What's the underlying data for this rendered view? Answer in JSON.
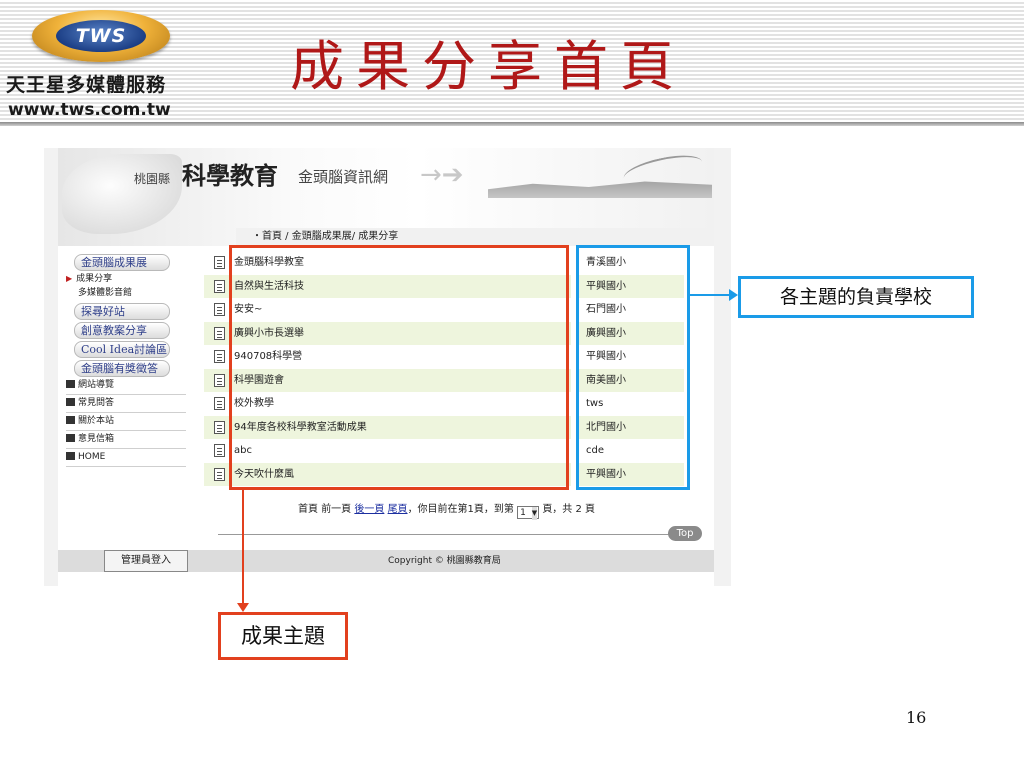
{
  "header": {
    "logo_text": "TWS",
    "brand_zh": "天王星多媒體服務",
    "brand_url": "www.tws.com.tw",
    "slide_title": "成果分享首頁"
  },
  "site": {
    "county": "桃園縣",
    "title": "科學教育",
    "subtitle": "金頭腦資訊網",
    "breadcrumb": "・首頁 / 金頭腦成果展/ 成果分享",
    "menu": {
      "section1": "金頭腦成果展",
      "item_share": "成果分享",
      "item_media": "多媒體影音館",
      "section2": "探尋好站",
      "section3": "創意教案分享",
      "section4": "Cool Idea討論區",
      "section5": "金頭腦有獎徵答",
      "util1": "網站導覽",
      "util2": "常見問答",
      "util3": "關於本站",
      "util4": "意見信箱",
      "util5": "HOME"
    },
    "rows": [
      {
        "topic": "金頭腦科學教室",
        "school": "青溪國小"
      },
      {
        "topic": "自然與生活科技",
        "school": "平興國小"
      },
      {
        "topic": "安安~",
        "school": "石門國小"
      },
      {
        "topic": "廣興小市長選舉",
        "school": "廣興國小"
      },
      {
        "topic": "940708科學營",
        "school": "平興國小"
      },
      {
        "topic": "科學園遊會",
        "school": "南美國小"
      },
      {
        "topic": "校外教學",
        "school": "tws"
      },
      {
        "topic": "94年度各校科學教室活動成果",
        "school": "北門國小"
      },
      {
        "topic": "abc",
        "school": "cde"
      },
      {
        "topic": "今天吹什麼風",
        "school": "平興國小"
      }
    ],
    "pager": {
      "first": "首頁",
      "prev": "前一頁",
      "next": "後一頁",
      "last": "尾頁",
      "current_text": "，你目前在第1頁，到第",
      "page_select": "1",
      "total_text": "頁，共 2 頁"
    },
    "top_button": "Top",
    "admin_button": "管理員登入",
    "copyright": "Copyright © 桃園縣教育局"
  },
  "annotations": {
    "school_label": "各主題的負責學校",
    "topic_label": "成果主題"
  },
  "page_number": "16",
  "colors": {
    "title_red": "#b01818",
    "annotation_red": "#e2401e",
    "annotation_blue": "#1a9be8",
    "row_highlight": "#eef5dd"
  }
}
